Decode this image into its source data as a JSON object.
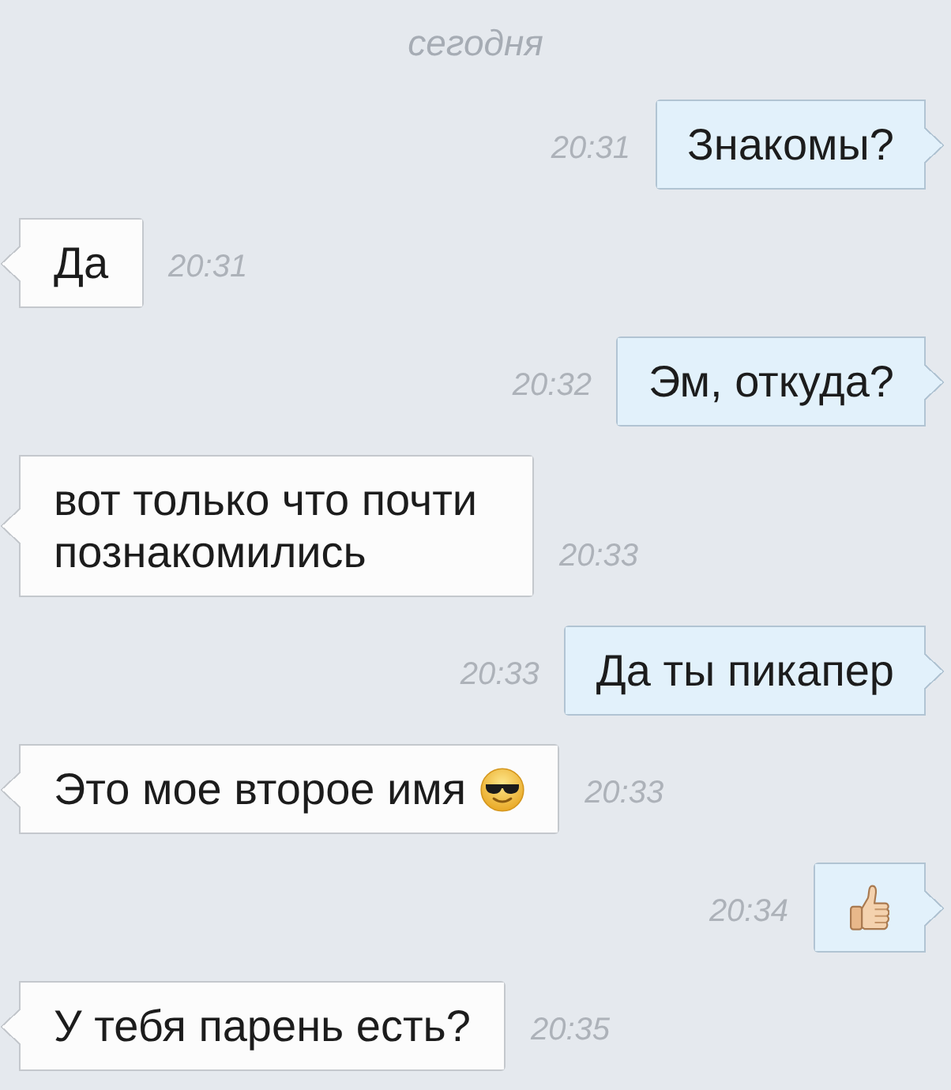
{
  "date_header": "сегодня",
  "messages": [
    {
      "outgoing": true,
      "kind": "text",
      "text": "Знакомы?",
      "time": "20:31"
    },
    {
      "outgoing": false,
      "kind": "text",
      "text": "Да",
      "time": "20:31"
    },
    {
      "outgoing": true,
      "kind": "text",
      "text": "Эм, откуда?",
      "time": "20:32"
    },
    {
      "outgoing": false,
      "kind": "text",
      "text": "вот только что почти познакомились",
      "time": "20:33"
    },
    {
      "outgoing": true,
      "kind": "text",
      "text": "Да ты пикапер",
      "time": "20:33"
    },
    {
      "outgoing": false,
      "kind": "text-emoji",
      "text": "Это мое второе имя",
      "time": "20:33"
    },
    {
      "outgoing": true,
      "kind": "emoji",
      "time": "20:34"
    },
    {
      "outgoing": false,
      "kind": "text",
      "text": "У тебя парень есть?",
      "time": "20:35"
    }
  ]
}
